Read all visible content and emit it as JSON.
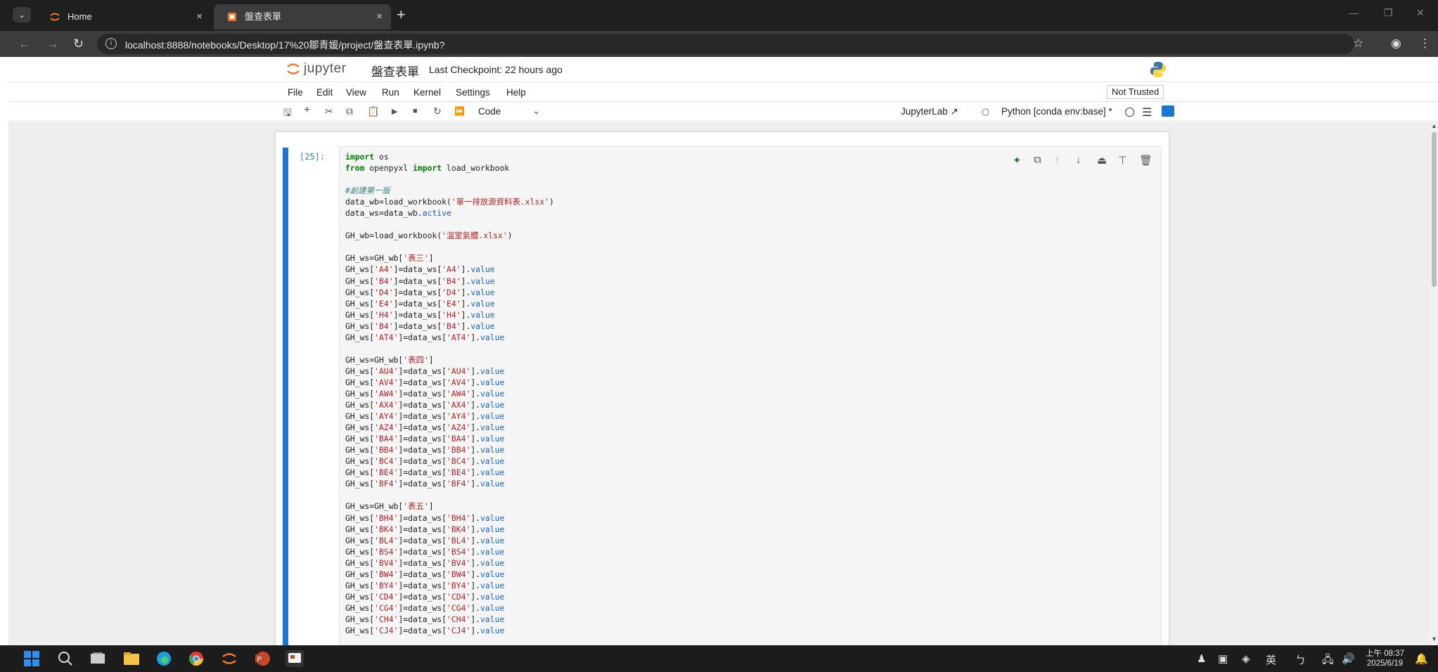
{
  "browser": {
    "tabs": [
      {
        "title": "Home",
        "close": "×"
      },
      {
        "title": "盤查表單",
        "close": "×"
      }
    ],
    "new_tab": "+",
    "url": "localhost:8888/notebooks/Desktop/17%20鄒青媛/project/盤查表單.ipynb?"
  },
  "jupyter": {
    "logo_text": "jupyter",
    "notebook_name": "盤查表單",
    "checkpoint": "Last Checkpoint: 22 hours ago",
    "menu": [
      "File",
      "Edit",
      "View",
      "Run",
      "Kernel",
      "Settings",
      "Help"
    ],
    "trust_label": "Not Trusted",
    "toolbar": {
      "cell_type": "Code",
      "jupyterlab_link": "JupyterLab ↗",
      "kernel": "Python [conda env:base] *"
    }
  },
  "cell": {
    "prompt": "[25]:",
    "lines": [
      "import os",
      "from openpyxl import load_workbook",
      "",
      "#創建第一版",
      "data_wb=load_workbook('單一排放源資料表.xlsx')",
      "data_ws=data_wb.active",
      "",
      "GH_wb=load_workbook('溫室氣體.xlsx')",
      "",
      "GH_ws=GH_wb['表三']",
      "GH_ws['A4']=data_ws['A4'].value",
      "GH_ws['B4']=data_ws['B4'].value",
      "GH_ws['D4']=data_ws['D4'].value",
      "GH_ws['E4']=data_ws['E4'].value",
      "GH_ws['H4']=data_ws['H4'].value",
      "GH_ws['B4']=data_ws['B4'].value",
      "GH_ws['AT4']=data_ws['AT4'].value",
      "",
      "GH_ws=GH_wb['表四']",
      "GH_ws['AU4']=data_ws['AU4'].value",
      "GH_ws['AV4']=data_ws['AV4'].value",
      "GH_ws['AW4']=data_ws['AW4'].value",
      "GH_ws['AX4']=data_ws['AX4'].value",
      "GH_ws['AY4']=data_ws['AY4'].value",
      "GH_ws['AZ4']=data_ws['AZ4'].value",
      "GH_ws['BA4']=data_ws['BA4'].value",
      "GH_ws['BB4']=data_ws['BB4'].value",
      "GH_ws['BC4']=data_ws['BC4'].value",
      "GH_ws['BE4']=data_ws['BE4'].value",
      "GH_ws['BF4']=data_ws['BF4'].value",
      "",
      "GH_ws=GH_wb['表五']",
      "GH_ws['BH4']=data_ws['BH4'].value",
      "GH_ws['BK4']=data_ws['BK4'].value",
      "GH_ws['BL4']=data_ws['BL4'].value",
      "GH_ws['BS4']=data_ws['BS4'].value",
      "GH_ws['BV4']=data_ws['BV4'].value",
      "GH_ws['BW4']=data_ws['BW4'].value",
      "GH_ws['BY4']=data_ws['BY4'].value",
      "GH_ws['CD4']=data_ws['CD4'].value",
      "GH_ws['CG4']=data_ws['CG4'].value",
      "GH_ws['CH4']=data_ws['CH4'].value",
      "GH_ws['CJ4']=data_ws['CJ4'].value"
    ]
  },
  "taskbar": {
    "ime_label": "英",
    "clock_time": "上午 08:37",
    "clock_date": "2025/6/19"
  },
  "colors": {
    "accent": "#1976d2",
    "keyword": "#008000",
    "string": "#ba2121",
    "attribute": "#1565c0"
  }
}
